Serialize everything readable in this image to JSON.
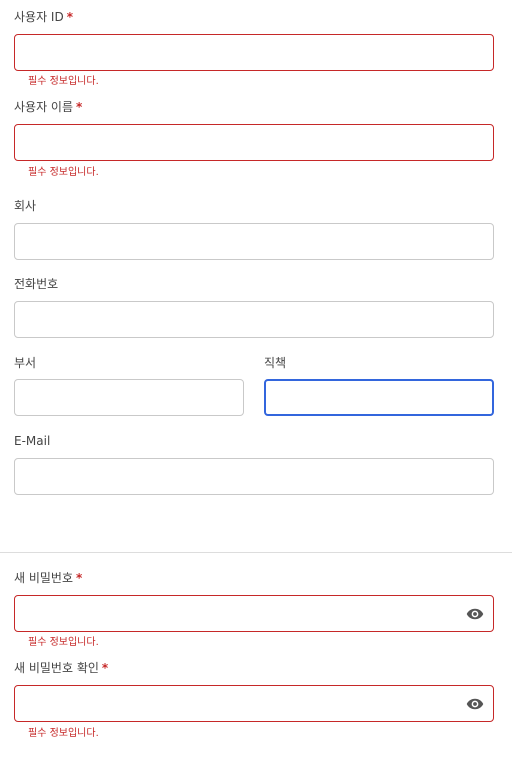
{
  "user_id": {
    "label": "사용자 ID",
    "required": "*",
    "value": "",
    "error": "필수 정보입니다."
  },
  "user_name": {
    "label": "사용자 이름",
    "required": "*",
    "value": "",
    "error": "필수 정보입니다."
  },
  "company": {
    "label": "회사",
    "value": ""
  },
  "phone": {
    "label": "전화번호",
    "value": ""
  },
  "department": {
    "label": "부서",
    "value": ""
  },
  "position": {
    "label": "직책",
    "value": ""
  },
  "email": {
    "label": "E-Mail",
    "value": ""
  },
  "new_password": {
    "label": "새 비밀번호",
    "required": "*",
    "value": "",
    "error": "필수 정보입니다.",
    "icon": "eye-icon"
  },
  "confirm_password": {
    "label": "새 비밀번호 확인",
    "required": "*",
    "value": "",
    "error": "필수 정보입니다.",
    "icon": "eye-icon"
  },
  "colors": {
    "error": "#c62828",
    "focus": "#3366dd",
    "border": "#c9c9c9"
  }
}
